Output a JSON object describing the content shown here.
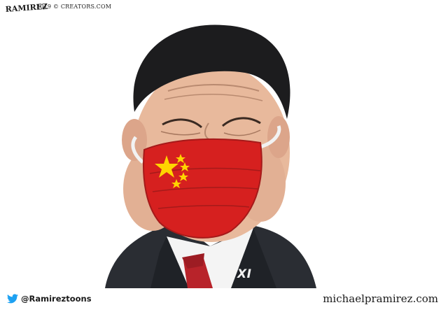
{
  "signature": "RAMIREZ",
  "copyright": "2019 © CREATORS.COM",
  "name_label": "XI",
  "footer": {
    "twitter_handle": "@Ramireztoons",
    "website": "michaelpramirez.com"
  },
  "colors": {
    "mask_red": "#d6201f",
    "star_yellow": "#ffd400",
    "tie_red": "#b8232a",
    "suit_dark": "#2a2d33",
    "skin": "#e8b99c",
    "hair": "#1c1c1e",
    "twitter_blue": "#1da1f2"
  },
  "icons": [
    "twitter-icon"
  ]
}
